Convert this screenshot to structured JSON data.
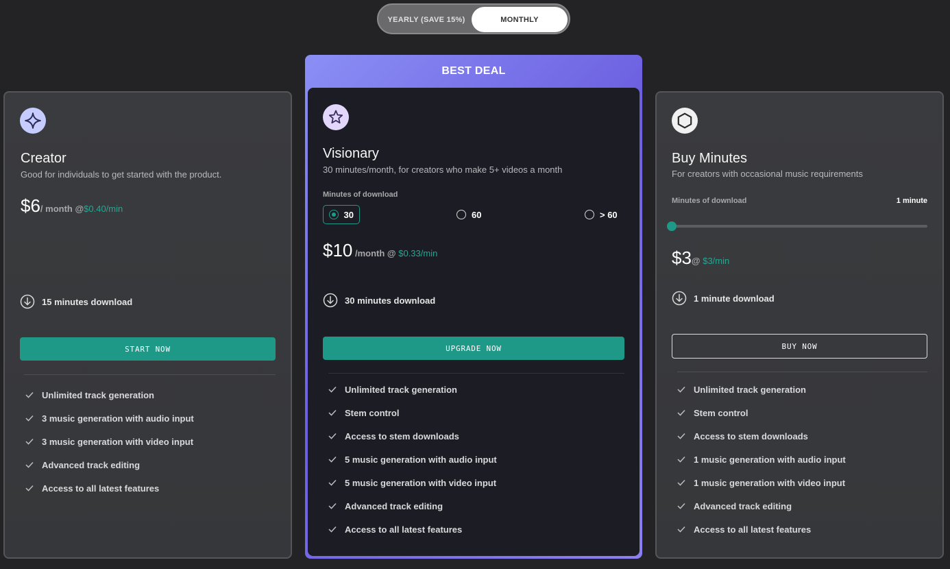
{
  "billing_toggle": {
    "yearly_label": "YEARLY (SAVE 15%)",
    "monthly_label": "MONTHLY",
    "selected": "MONTHLY"
  },
  "plans": {
    "creator": {
      "icon": "sparkle-star-icon",
      "name": "Creator",
      "description": "Good for individuals to get started with the product.",
      "price": "$6",
      "per": "/ month @ ",
      "rate": "$0.40/min",
      "download": "15 minutes download",
      "cta": "START NOW",
      "features": [
        "Unlimited track generation",
        "3 music generation with audio input",
        "3 music generation with video input",
        "Advanced track editing",
        "Access to all latest features"
      ]
    },
    "visionary": {
      "badge": "BEST DEAL",
      "icon": "star-icon",
      "name": "Visionary",
      "description": "30 minutes/month, for creators who make 5+ videos a month",
      "minutes_label": "Minutes of download",
      "options": [
        "30",
        "60",
        "> 60"
      ],
      "selected_option": "30",
      "price": "$10",
      "per": " /month @ ",
      "rate": "$0.33/min",
      "download": "30 minutes download",
      "cta": "UPGRADE NOW",
      "features": [
        "Unlimited track generation",
        "Stem control",
        "Access to stem downloads",
        "5 music generation with audio input",
        "5 music generation with video input",
        "Advanced track editing",
        "Access to all latest features"
      ]
    },
    "buy_minutes": {
      "icon": "hexagon-icon",
      "name": "Buy Minutes",
      "description": "For creators with occasional music requirements",
      "minutes_label": "Minutes of download",
      "slider_value_label": "1 minute",
      "slider_fraction": 0,
      "price": "$3",
      "per": "@ ",
      "rate": "$3/min",
      "download": "1 minute download",
      "cta": "BUY NOW",
      "features": [
        "Unlimited track generation",
        "Stem control",
        "Access to stem downloads",
        "1 music generation with audio input",
        "1 music generation with video input",
        "Advanced track editing",
        "Access to all latest features"
      ]
    }
  },
  "colors": {
    "background": "#232326",
    "accent": "#1e9887",
    "featured_gradient_start": "#8b8ff5",
    "featured_gradient_end": "#6c5fe0"
  }
}
